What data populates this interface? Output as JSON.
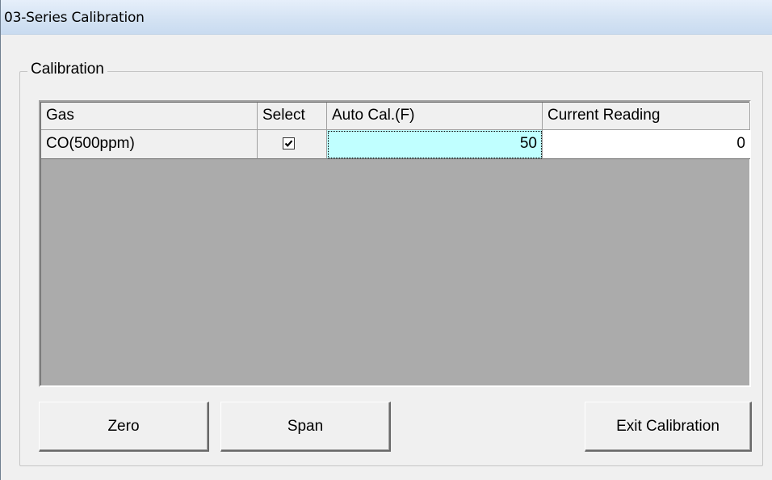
{
  "window": {
    "title": "03-Series Calibration"
  },
  "group": {
    "label": "Calibration"
  },
  "grid": {
    "columns": [
      "Gas",
      "Select",
      "Auto Cal.(F)",
      "Current Reading"
    ],
    "rows": [
      {
        "gas": "CO(500ppm)",
        "select": true,
        "auto_cal": "50",
        "current_reading": "0"
      }
    ],
    "selected_cell_color": "#c0ffff",
    "empty_area_color": "#ababab"
  },
  "buttons": {
    "zero": "Zero",
    "span": "Span",
    "exit": "Exit Calibration"
  },
  "icons": {
    "checkbox": "checkmark-icon"
  }
}
